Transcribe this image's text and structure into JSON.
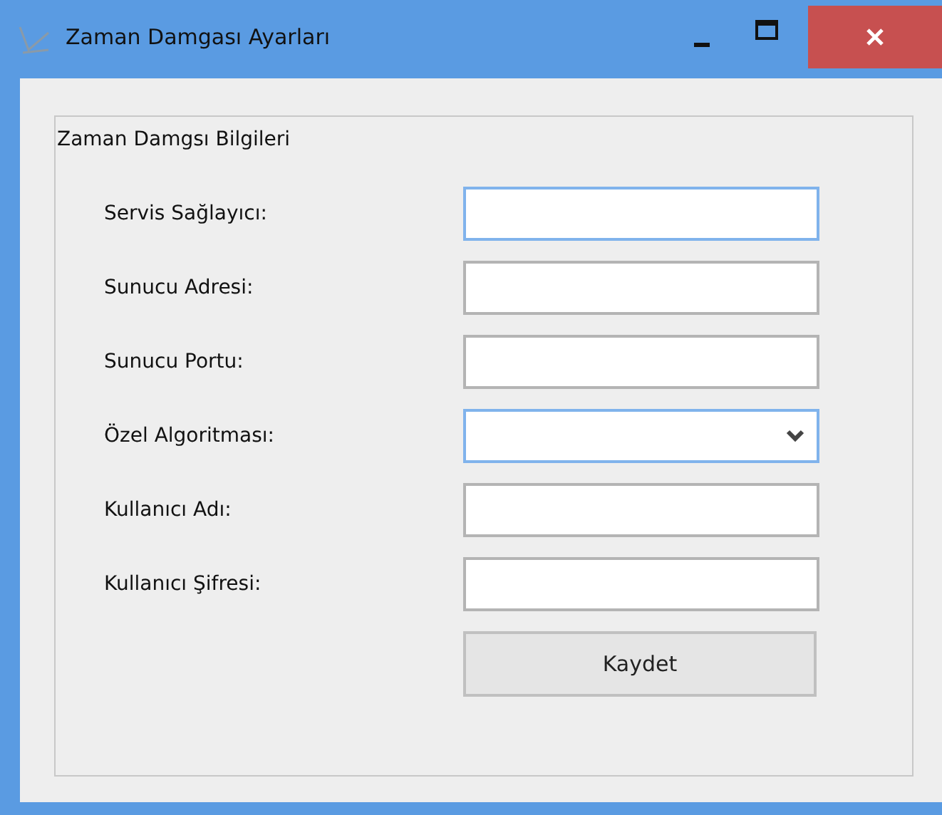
{
  "window": {
    "title": "Zaman Damgası Ayarları"
  },
  "group": {
    "title": "Zaman Damgsı Bilgileri",
    "fields": [
      {
        "label": "Servis Sağlayıcı:",
        "kind": "text",
        "focused": true
      },
      {
        "label": "Sunucu Adresi:",
        "kind": "text",
        "focused": false
      },
      {
        "label": "Sunucu Portu:",
        "kind": "text",
        "focused": false
      },
      {
        "label": "Özel Algoritması:",
        "kind": "dropdown",
        "focused": true
      },
      {
        "label": "Kullanıcı Adı:",
        "kind": "text",
        "focused": false
      },
      {
        "label": "Kullanıcı Şifresi:",
        "kind": "text",
        "focused": false
      }
    ],
    "button": "Kaydet"
  }
}
